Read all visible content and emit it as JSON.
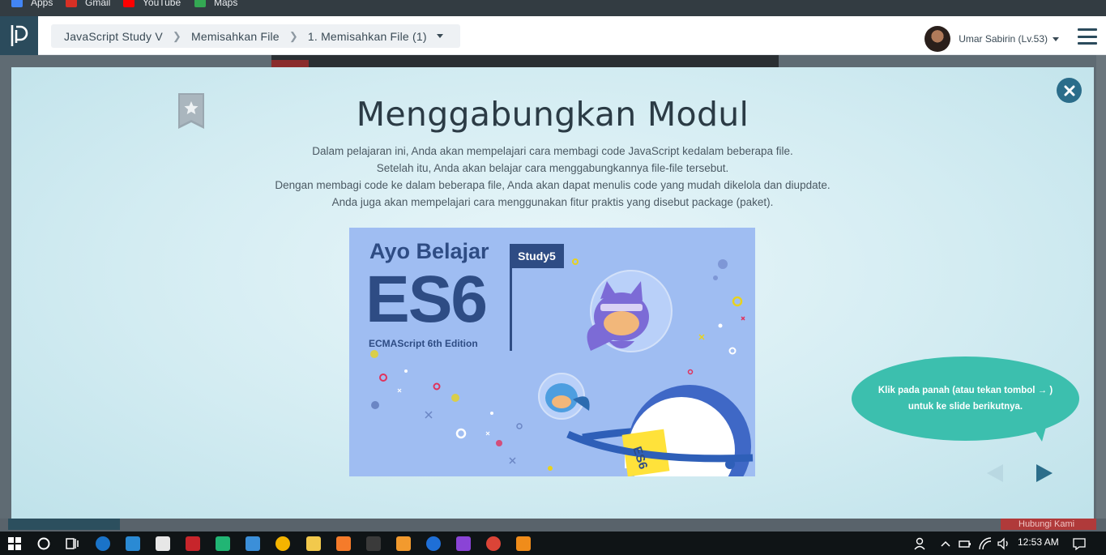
{
  "bookmarks": [
    {
      "label": "Apps",
      "icon": "apps-grid-icon",
      "color": "#4285f4"
    },
    {
      "label": "Gmail",
      "icon": "gmail-icon",
      "color": "#d93025"
    },
    {
      "label": "YouTube",
      "icon": "youtube-icon",
      "color": "#ff0000"
    },
    {
      "label": "Maps",
      "icon": "maps-icon",
      "color": "#34a853"
    }
  ],
  "header": {
    "breadcrumb": [
      "JavaScript Study V",
      "Memisahkan File",
      "1. Memisahkan File (1)"
    ],
    "user": "Umar Sabirin (Lv.53)"
  },
  "modal": {
    "title": "Menggabungkan Modul",
    "description": [
      "Dalam pelajaran ini, Anda akan mempelajari cara membagi code JavaScript kedalam beberapa file.",
      "Setelah itu, Anda akan belajar cara menggabungkannya file-file tersebut.",
      "Dengan membagi code ke dalam beberapa file, Anda akan dapat menulis code yang mudah dikelola dan diupdate.",
      "Anda juga akan mempelajari cara menggunakan fitur praktis yang disebut package (paket)."
    ],
    "illustration": {
      "heading": "Ayo Belajar",
      "big": "ES6",
      "subtitle": "ECMAScript 6th Edition",
      "tag": "Study5",
      "planet_label": "ES6"
    },
    "tooltip": "Klik pada panah (atau tekan tombol → ) untuk ke slide berikutnya."
  },
  "background": {
    "bottom_right_label": "Hubungi Kami"
  },
  "taskbar": {
    "clock": "12:53 AM",
    "apps": [
      "start-icon",
      "search-icon",
      "task-view-icon",
      "edge-icon",
      "mail-icon",
      "store-icon",
      "filezilla-icon",
      "pycharm-icon",
      "media-player-icon",
      "chrome-icon",
      "file-explorer-icon",
      "xampp-icon",
      "git-icon",
      "sublime-icon",
      "maps-pin-icon",
      "phpstorm-icon",
      "chrome-active-icon",
      "vlc-icon"
    ]
  },
  "colors": {
    "header_dark": "#2b4b5c",
    "close_button": "#2b6d8a",
    "tooltip": "#3cbfae",
    "illustration_bg": "#9fbdf2",
    "illustration_text": "#2e4c84"
  }
}
